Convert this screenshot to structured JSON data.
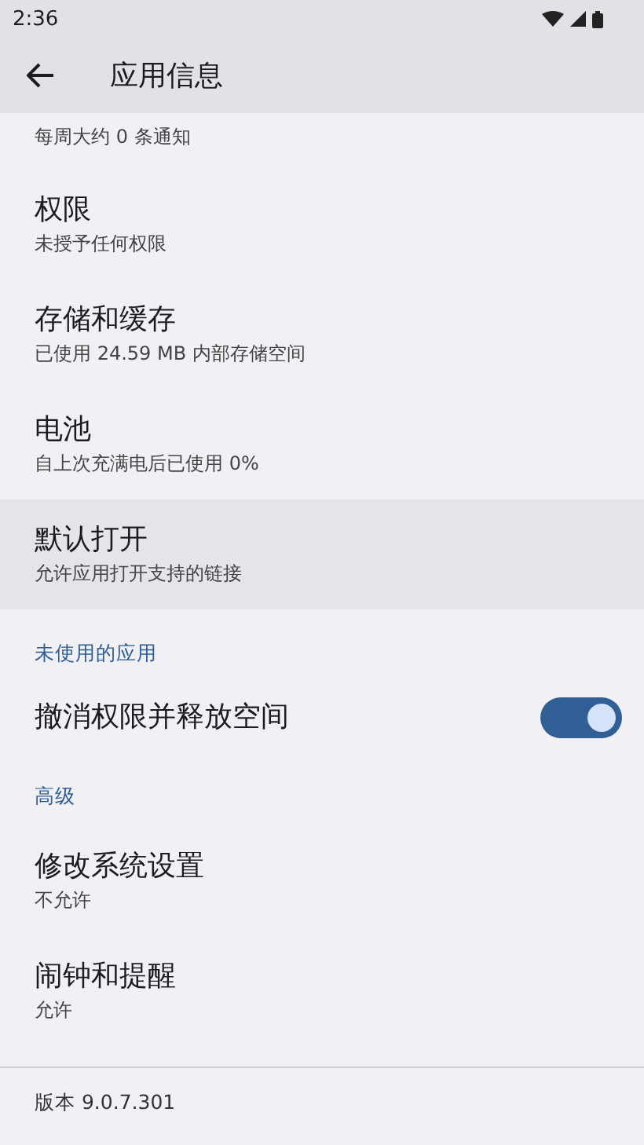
{
  "status_bar": {
    "time": "2:36"
  },
  "app_bar": {
    "title": "应用信息"
  },
  "sections": [
    {
      "items": [
        {
          "kind": "text",
          "subtitle": "每周大约 0 条通知",
          "selected": false
        },
        {
          "kind": "text",
          "title": "权限",
          "subtitle": "未授予任何权限",
          "selected": false
        },
        {
          "kind": "text",
          "title": "存储和缓存",
          "subtitle": "已使用 24.59 MB 内部存储空间",
          "selected": false
        },
        {
          "kind": "text",
          "title": "电池",
          "subtitle": "自上次充满电后已使用 0%",
          "selected": false
        },
        {
          "kind": "text",
          "title": "默认打开",
          "subtitle": "允许应用打开支持的链接",
          "selected": true
        }
      ]
    },
    {
      "header": "未使用的应用",
      "items": [
        {
          "kind": "switch",
          "title": "撤消权限并释放空间",
          "on": true,
          "selected": false
        }
      ]
    },
    {
      "header": "高级",
      "items": [
        {
          "kind": "text",
          "title": "修改系统设置",
          "subtitle": "不允许",
          "selected": false
        },
        {
          "kind": "text",
          "title": "闹钟和提醒",
          "subtitle": "允许",
          "selected": false
        }
      ]
    }
  ],
  "footer": {
    "version": "版本 9.0.7.301"
  }
}
